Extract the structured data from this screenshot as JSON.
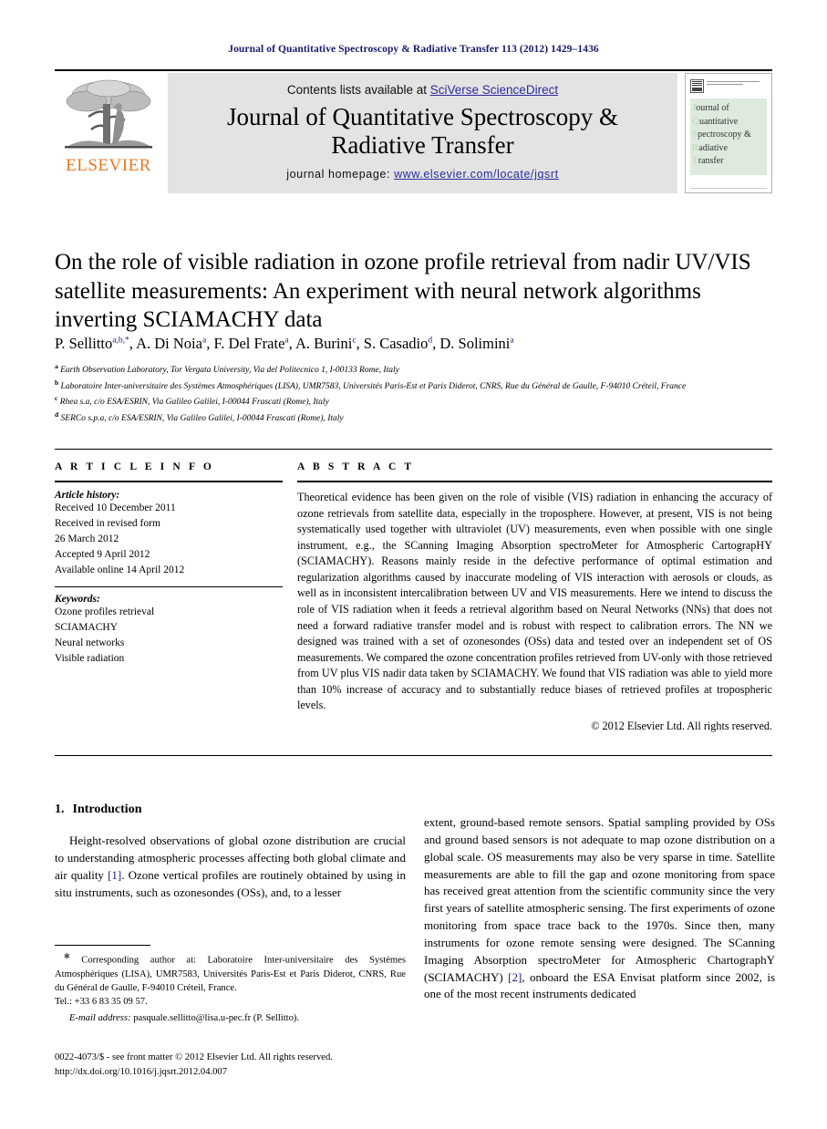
{
  "running_head": "Journal of Quantitative Spectroscopy & Radiative Transfer 113 (2012) 1429–1436",
  "masthead": {
    "publisher_name": "ELSEVIER",
    "contents_prefix": "Contents lists available at ",
    "contents_link": "SciVerse ScienceDirect",
    "journal_title_line1": "Journal of Quantitative Spectroscopy &",
    "journal_title_line2": "Radiative Transfer",
    "homepage_prefix": "journal homepage: ",
    "homepage_url": "www.elsevier.com/locate/jqsrt",
    "cover": {
      "lines": [
        {
          "cap": "J",
          "rest": "ournal of"
        },
        {
          "cap": "Q",
          "rest": "uantitative"
        },
        {
          "cap": "S",
          "rest": "pectroscopy &"
        },
        {
          "cap": "R",
          "rest": "adiative"
        },
        {
          "cap": "T",
          "rest": "ransfer"
        }
      ]
    }
  },
  "article": {
    "title": "On the role of visible radiation in ozone profile retrieval from nadir UV/VIS satellite measurements: An experiment with neural network algorithms inverting SCIAMACHY data",
    "authors": [
      {
        "name": "P. Sellitto",
        "marks": "a,b",
        "corresponding": true
      },
      {
        "name": "A. Di Noia",
        "marks": "a",
        "corresponding": false
      },
      {
        "name": "F. Del Frate",
        "marks": "a",
        "corresponding": false
      },
      {
        "name": "A. Burini",
        "marks": "c",
        "corresponding": false
      },
      {
        "name": "S. Casadio",
        "marks": "d",
        "corresponding": false
      },
      {
        "name": "D. Solimini",
        "marks": "a",
        "corresponding": false
      }
    ],
    "affiliations": [
      {
        "mark": "a",
        "text": "Earth Observation Laboratory, Tor Vergata University, Via del Politecnico 1, I-00133 Rome, Italy"
      },
      {
        "mark": "b",
        "text": "Laboratoire Inter-universitaire des Systèmes Atmosphériques (LISA), UMR7583, Universités Paris-Est et Paris Diderot, CNRS, Rue du Général de Gaulle, F-94010 Créteil, France"
      },
      {
        "mark": "c",
        "text": "Rhea s.a, c/o ESA/ESRIN, Via Galileo Galilei, I-00044 Frascati (Rome), Italy"
      },
      {
        "mark": "d",
        "text": "SERCo s.p.a, c/o ESA/ESRIN, Via Galileo Galilei, I-00044 Frascati (Rome), Italy"
      }
    ]
  },
  "article_info": {
    "heading": "A R T I C L E   I N F O",
    "history_label": "Article history:",
    "history": [
      "Received 10 December 2011",
      "Received in revised form",
      "26 March 2012",
      "Accepted 9 April 2012",
      "Available online 14 April 2012"
    ],
    "keywords_label": "Keywords:",
    "keywords": [
      "Ozone profiles retrieval",
      "SCIAMACHY",
      "Neural networks",
      "Visible radiation"
    ]
  },
  "abstract": {
    "heading": "A B S T R A C T",
    "text": "Theoretical evidence has been given on the role of visible (VIS) radiation in enhancing the accuracy of ozone retrievals from satellite data, especially in the troposphere. However, at present, VIS is not being systematically used together with ultraviolet (UV) measurements, even when possible with one single instrument, e.g., the SCanning Imaging Absorption spectroMeter for Atmospheric CartograpHY (SCIAMACHY). Reasons mainly reside in the defective performance of optimal estimation and regularization algorithms caused by inaccurate modeling of VIS interaction with aerosols or clouds, as well as in inconsistent intercalibration between UV and VIS measurements. Here we intend to discuss the role of VIS radiation when it feeds a retrieval algorithm based on Neural Networks (NNs) that does not need a forward radiative transfer model and is robust with respect to calibration errors. The NN we designed was trained with a set of ozonesondes (OSs) data and tested over an independent set of OS measurements. We compared the ozone concentration profiles retrieved from UV-only with those retrieved from UV plus VIS nadir data taken by SCIAMACHY. We found that VIS radiation was able to yield more than 10% increase of accuracy and to substantially reduce biases of retrieved profiles at tropospheric levels.",
    "copyright": "© 2012 Elsevier Ltd. All rights reserved."
  },
  "body": {
    "section_number": "1.",
    "section_title": "Introduction",
    "left_paragraph": "Height-resolved observations of global ozone distribution are crucial to understanding atmospheric processes affecting both global climate and air quality [1]. Ozone vertical profiles are routinely obtained by using in situ instruments, such as ozonesondes (OSs), and, to a lesser",
    "left_ref": "[1]",
    "right_paragraph": "extent, ground-based remote sensors. Spatial sampling provided by OSs and ground based sensors is not adequate to map ozone distribution on a global scale. OS measurements may also be very sparse in time. Satellite measurements are able to fill the gap and ozone monitoring from space has received great attention from the scientific community since the very first years of satellite atmospheric sensing. The first experiments of ozone monitoring from space trace back to the 1970s. Since then, many instruments for ozone remote sensing were designed. The SCanning Imaging Absorption spectroMeter for Atmospheric ChartographY (SCIAMACHY) [2], onboard the ESA Envisat platform since 2002, is one of the most recent instruments dedicated",
    "right_ref": "[2]"
  },
  "footnote": {
    "marker": "✻",
    "corresponding_text": "Corresponding author at: Laboratoire Inter-universitaire des Systèmes Atmosphériques (LISA), UMR7583, Universités Paris-Est et Paris Diderot, CNRS, Rue du Général de Gaulle, F-94010 Créteil, France.",
    "tel": "Tel.: +33 6 83 35 09 57.",
    "email_label": "E-mail address:",
    "email": "pasquale.sellitto@lisa.u-pec.fr (P. Sellitto)."
  },
  "imprint": {
    "line1": "0022-4073/$ - see front matter © 2012 Elsevier Ltd. All rights reserved.",
    "line2": "http://dx.doi.org/10.1016/j.jqsrt.2012.04.007"
  }
}
